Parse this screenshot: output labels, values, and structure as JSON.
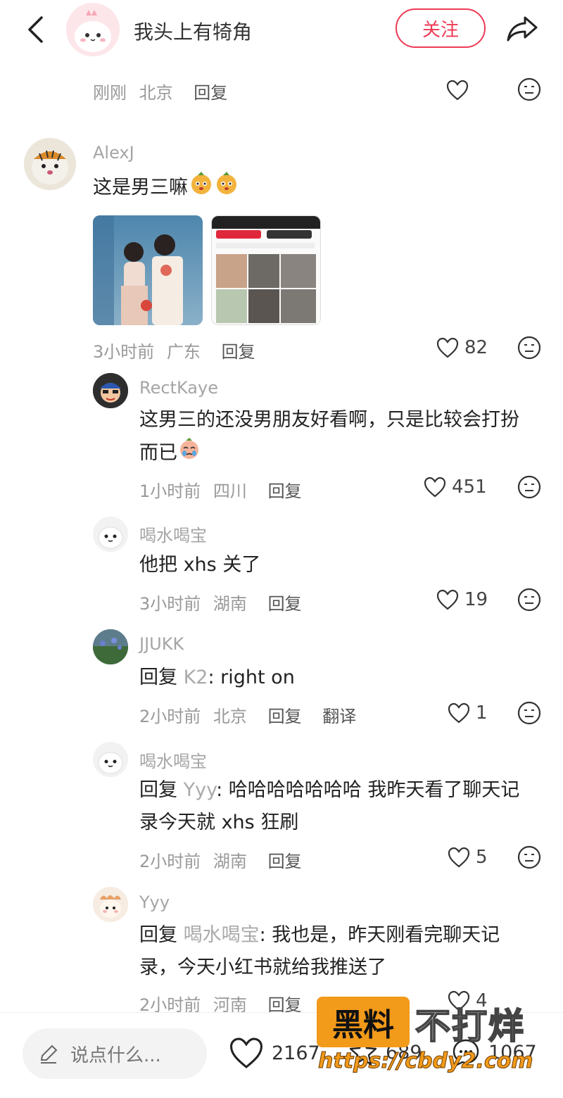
{
  "header": {
    "author_name": "我头上有犄角",
    "follow_label": "关注"
  },
  "top_meta": {
    "time": "刚刚",
    "location": "北京",
    "reply": "回复"
  },
  "comments": [
    {
      "user": "AlexJ",
      "text": "这是男三嘛",
      "time": "3小时前",
      "location": "广东",
      "reply": "回复",
      "likes": "82"
    }
  ],
  "replies": [
    {
      "user": "RectKaye",
      "text_line1": "这男三的还没男朋友好看啊，只是比较会打扮",
      "text_line2": "而已",
      "time": "1小时前",
      "location": "四川",
      "reply": "回复",
      "likes": "451"
    },
    {
      "user": "喝水喝宝",
      "text": "他把 xhs 关了",
      "time": "3小时前",
      "location": "湖南",
      "reply": "回复",
      "likes": "19"
    },
    {
      "user": "JJUKK",
      "reply_prefix": "回复",
      "reply_to": "K2",
      "text": ": right on",
      "time": "2小时前",
      "location": "北京",
      "reply": "回复",
      "translate": "翻译",
      "likes": "1"
    },
    {
      "user": "喝水喝宝",
      "reply_prefix": "回复",
      "reply_to": "Yyy",
      "text_line1": ": 哈哈哈哈哈哈哈 我昨天看了聊天记",
      "text_line2": "录今天就 xhs 狂刷",
      "time": "2小时前",
      "location": "湖南",
      "reply": "回复",
      "likes": "5"
    },
    {
      "user": "Yyy",
      "reply_prefix": "回复",
      "reply_to": "喝水喝宝",
      "text_line1": ": 我也是，昨天刚看完聊天记",
      "text_line2": "录，今天小红书就给我推送了",
      "time": "2小时前",
      "location": "河南",
      "reply": "回复",
      "likes": "4"
    }
  ],
  "bottom_bar": {
    "input_placeholder": "说点什么...",
    "likes": "2167",
    "collects": "689",
    "comments": "1067"
  },
  "watermark": {
    "box_text": "黑料",
    "right_text": "不打烊",
    "url": "https://cbdy2.com"
  },
  "colors": {
    "accent": "#ef3a55",
    "watermark_orange": "#f29a1a"
  },
  "icons": [
    "back-icon",
    "share-icon",
    "heart-icon",
    "emoji-icon",
    "pencil-icon",
    "star-icon",
    "comment-icon"
  ]
}
